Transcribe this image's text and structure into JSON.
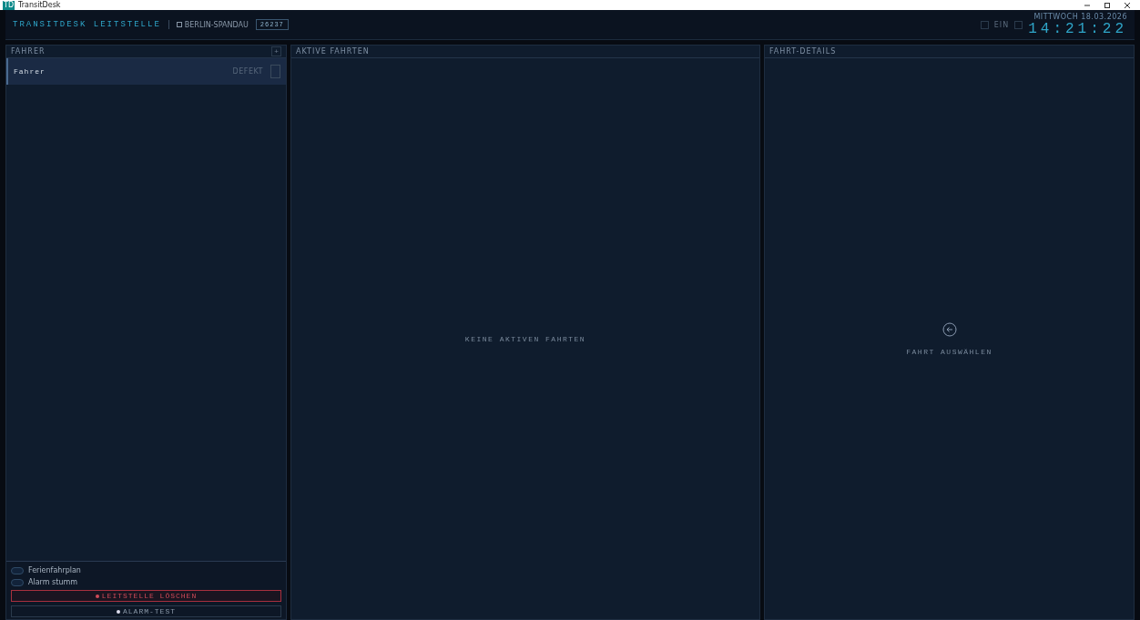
{
  "window": {
    "title": "TransitDesk",
    "app_badge": "TD"
  },
  "header": {
    "title": "TRANSITDESK LEITSTELLE",
    "location": "BERLIN-SPANDAU",
    "code": "26237",
    "toggle_label": "EIN",
    "date": "MITTWOCH 18.03.2026",
    "time": "14:21:22"
  },
  "drivers": {
    "title": "FAHRER",
    "add": "+",
    "items": [
      {
        "name": "Fahrer",
        "status": "DEFEKT",
        "selected": true
      }
    ]
  },
  "trips": {
    "title": "AKTIVE FAHRTEN",
    "empty": "KEINE AKTIVEN FAHRTEN"
  },
  "details": {
    "title": "FAHRT-DETAILS",
    "empty": "FAHRT AUSWÄHLEN"
  },
  "settings": [
    {
      "label": "Ferienfahrplan",
      "on": false
    },
    {
      "label": "Alarm stumm",
      "on": false
    }
  ],
  "buttons": [
    {
      "kind": "danger",
      "label": "LEITSTELLE LÖSCHEN"
    },
    {
      "kind": "plain",
      "label": "ALARM-TEST"
    }
  ]
}
